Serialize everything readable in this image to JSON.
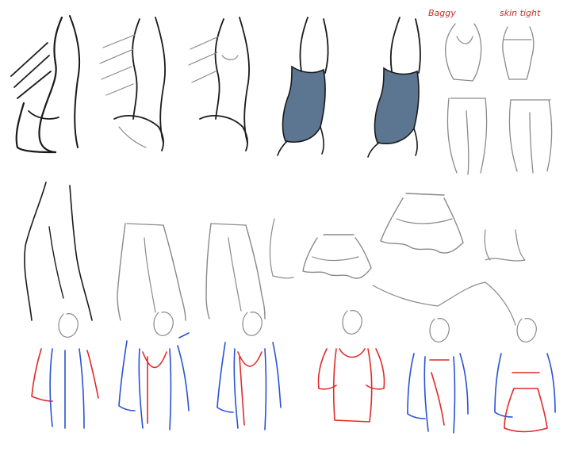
{
  "labels": {
    "baggy": "Baggy",
    "skin_tight": "skin tight"
  },
  "colors": {
    "background": "#ffffff",
    "ink": "#1a1a1a",
    "sketch": "#8a8a8a",
    "fill_blue": "#5c7590",
    "accent_red": "#e02a2a",
    "accent_blue": "#2a52d4"
  }
}
